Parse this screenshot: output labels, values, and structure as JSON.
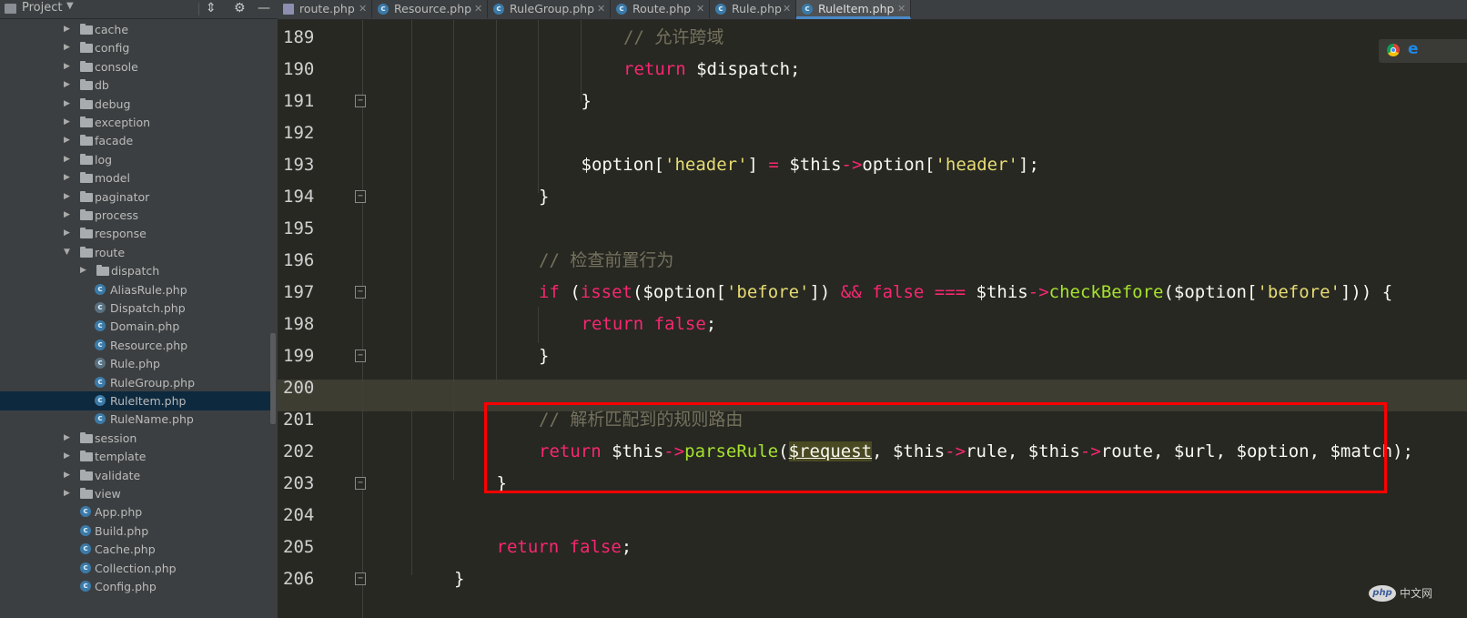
{
  "sidebar": {
    "title": "Project",
    "header_icons": [
      "collapse-icon",
      "gear-icon",
      "minimize-icon"
    ],
    "tree": [
      {
        "name": "cache",
        "type": "folder",
        "expanded": false
      },
      {
        "name": "config",
        "type": "folder",
        "expanded": false
      },
      {
        "name": "console",
        "type": "folder",
        "expanded": false
      },
      {
        "name": "db",
        "type": "folder",
        "expanded": false
      },
      {
        "name": "debug",
        "type": "folder",
        "expanded": false
      },
      {
        "name": "exception",
        "type": "folder",
        "expanded": false
      },
      {
        "name": "facade",
        "type": "folder",
        "expanded": false
      },
      {
        "name": "log",
        "type": "folder",
        "expanded": false
      },
      {
        "name": "model",
        "type": "folder",
        "expanded": false
      },
      {
        "name": "paginator",
        "type": "folder",
        "expanded": false
      },
      {
        "name": "process",
        "type": "folder",
        "expanded": false
      },
      {
        "name": "response",
        "type": "folder",
        "expanded": false
      },
      {
        "name": "route",
        "type": "folder",
        "expanded": true
      },
      {
        "name": "dispatch",
        "type": "folder",
        "expanded": false,
        "child": true
      },
      {
        "name": "AliasRule.php",
        "type": "class",
        "child": true
      },
      {
        "name": "Dispatch.php",
        "type": "abstract",
        "child": true
      },
      {
        "name": "Domain.php",
        "type": "class",
        "child": true
      },
      {
        "name": "Resource.php",
        "type": "class",
        "child": true
      },
      {
        "name": "Rule.php",
        "type": "abstract",
        "child": true
      },
      {
        "name": "RuleGroup.php",
        "type": "class",
        "child": true
      },
      {
        "name": "RuleItem.php",
        "type": "class",
        "child": true,
        "selected": true
      },
      {
        "name": "RuleName.php",
        "type": "class",
        "child": true
      },
      {
        "name": "session",
        "type": "folder",
        "expanded": false
      },
      {
        "name": "template",
        "type": "folder",
        "expanded": false
      },
      {
        "name": "validate",
        "type": "folder",
        "expanded": false
      },
      {
        "name": "view",
        "type": "folder",
        "expanded": false
      },
      {
        "name": "App.php",
        "type": "class"
      },
      {
        "name": "Build.php",
        "type": "class"
      },
      {
        "name": "Cache.php",
        "type": "class"
      },
      {
        "name": "Collection.php",
        "type": "class"
      },
      {
        "name": "Config.php",
        "type": "class"
      }
    ]
  },
  "tabs": [
    {
      "label": "route.php",
      "icon": "php-file-icon"
    },
    {
      "label": "Resource.php",
      "icon": "class-icon"
    },
    {
      "label": "RuleGroup.php",
      "icon": "class-icon"
    },
    {
      "label": "Route.php",
      "icon": "class-icon"
    },
    {
      "label": "Rule.php",
      "icon": "abstract-class-icon"
    },
    {
      "label": "RuleItem.php",
      "icon": "class-icon",
      "active": true
    }
  ],
  "editor": {
    "current_line": "200",
    "lines": [
      {
        "n": "189",
        "indent": 8,
        "fold": false,
        "tokens": [
          {
            "t": "// 允许跨域",
            "c": "comment"
          }
        ]
      },
      {
        "n": "190",
        "indent": 8,
        "fold": false,
        "tokens": [
          {
            "t": "return",
            "c": "kw"
          },
          {
            "t": " $dispatch;",
            "c": "var"
          }
        ]
      },
      {
        "n": "191",
        "indent": 7,
        "fold": true,
        "tokens": [
          {
            "t": "}",
            "c": "var"
          }
        ]
      },
      {
        "n": "192",
        "indent": 0,
        "fold": false,
        "tokens": []
      },
      {
        "n": "193",
        "indent": 7,
        "fold": false,
        "tokens": [
          {
            "t": "$option[",
            "c": "var"
          },
          {
            "t": "'header'",
            "c": "str"
          },
          {
            "t": "] ",
            "c": "var"
          },
          {
            "t": "=",
            "c": "op"
          },
          {
            "t": " $this",
            "c": "var"
          },
          {
            "t": "->",
            "c": "op"
          },
          {
            "t": "option[",
            "c": "var"
          },
          {
            "t": "'header'",
            "c": "str"
          },
          {
            "t": "];",
            "c": "var"
          }
        ]
      },
      {
        "n": "194",
        "indent": 6,
        "fold": true,
        "tokens": [
          {
            "t": "}",
            "c": "var"
          }
        ]
      },
      {
        "n": "195",
        "indent": 0,
        "fold": false,
        "tokens": []
      },
      {
        "n": "196",
        "indent": 6,
        "fold": false,
        "tokens": [
          {
            "t": "// 检查前置行为",
            "c": "comment"
          }
        ]
      },
      {
        "n": "197",
        "indent": 6,
        "fold": true,
        "tokens": [
          {
            "t": "if",
            "c": "kw"
          },
          {
            "t": " (",
            "c": "var"
          },
          {
            "t": "isset",
            "c": "kw"
          },
          {
            "t": "($option[",
            "c": "var"
          },
          {
            "t": "'before'",
            "c": "str"
          },
          {
            "t": "]) ",
            "c": "var"
          },
          {
            "t": "&&",
            "c": "op"
          },
          {
            "t": " ",
            "c": "var"
          },
          {
            "t": "false",
            "c": "kw"
          },
          {
            "t": " ",
            "c": "var"
          },
          {
            "t": "===",
            "c": "op"
          },
          {
            "t": " $this",
            "c": "var"
          },
          {
            "t": "->",
            "c": "op"
          },
          {
            "t": "checkBefore",
            "c": "fn"
          },
          {
            "t": "($option[",
            "c": "var"
          },
          {
            "t": "'before'",
            "c": "str"
          },
          {
            "t": "])) {",
            "c": "var"
          }
        ]
      },
      {
        "n": "198",
        "indent": 7,
        "fold": false,
        "tokens": [
          {
            "t": "return",
            "c": "kw"
          },
          {
            "t": " ",
            "c": "var"
          },
          {
            "t": "false",
            "c": "kw"
          },
          {
            "t": ";",
            "c": "var"
          }
        ]
      },
      {
        "n": "199",
        "indent": 6,
        "fold": true,
        "tokens": [
          {
            "t": "}",
            "c": "var"
          }
        ]
      },
      {
        "n": "200",
        "indent": 0,
        "fold": false,
        "tokens": []
      },
      {
        "n": "201",
        "indent": 6,
        "fold": false,
        "tokens": [
          {
            "t": "// 解析匹配到的规则路由",
            "c": "comment"
          }
        ]
      },
      {
        "n": "202",
        "indent": 6,
        "fold": false,
        "tokens": [
          {
            "t": "return",
            "c": "kw"
          },
          {
            "t": " $this",
            "c": "var"
          },
          {
            "t": "->",
            "c": "op"
          },
          {
            "t": "parseRule",
            "c": "fn"
          },
          {
            "t": "(",
            "c": "var"
          },
          {
            "t": "$request",
            "c": "hl"
          },
          {
            "t": ", $this",
            "c": "var"
          },
          {
            "t": "->",
            "c": "op"
          },
          {
            "t": "rule, $this",
            "c": "var"
          },
          {
            "t": "->",
            "c": "op"
          },
          {
            "t": "route, $url, $option, $match);",
            "c": "var"
          }
        ]
      },
      {
        "n": "203",
        "indent": 5,
        "fold": true,
        "tokens": [
          {
            "t": "}",
            "c": "var"
          }
        ]
      },
      {
        "n": "204",
        "indent": 0,
        "fold": false,
        "tokens": []
      },
      {
        "n": "205",
        "indent": 5,
        "fold": false,
        "tokens": [
          {
            "t": "return",
            "c": "kw"
          },
          {
            "t": " ",
            "c": "var"
          },
          {
            "t": "false",
            "c": "kw"
          },
          {
            "t": ";",
            "c": "var"
          }
        ]
      },
      {
        "n": "206",
        "indent": 4,
        "fold": true,
        "tokens": [
          {
            "t": "}",
            "c": "var"
          }
        ]
      }
    ]
  },
  "annotation": {
    "color": "#ff0000",
    "lines": [
      "201",
      "202"
    ]
  },
  "browser_icons": [
    "chrome-icon",
    "ie-icon"
  ],
  "watermark": {
    "logo": "php",
    "text": "中文网"
  },
  "colors": {
    "editor_bg": "#272822",
    "comment": "#75715e",
    "keyword": "#f92672",
    "string": "#e6db74",
    "function": "#a6e22e",
    "text": "#f8f8f2"
  }
}
